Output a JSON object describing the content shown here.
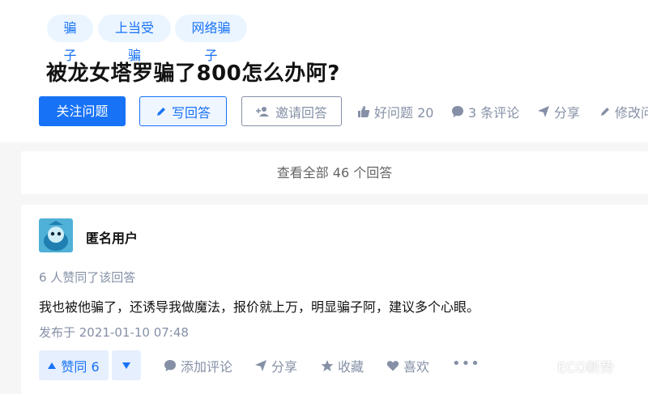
{
  "tags": [
    "骗子",
    "上当受骗",
    "网络骗子"
  ],
  "question": {
    "title": "被龙女塔罗骗了800怎么办阿?",
    "follow_label": "关注问题",
    "write_label": "写回答",
    "invite_label": "邀请回答",
    "good_question_label": "好问题 20",
    "comments_label": "3 条评论",
    "share_label": "分享",
    "edit_label": "修改问"
  },
  "view_all": "查看全部 46 个回答",
  "answer": {
    "author": "匿名用户",
    "likes_text": "6 人赞同了该回答",
    "content": "我也被他骗了，还诱导我做魔法，报价就上万，明显骗子阿，建议多个心眼。",
    "published": "发布于 2021-01-10 07:48",
    "vote_label": "赞同 6",
    "comment_label": "添加评论",
    "share_label": "分享",
    "collect_label": "收藏",
    "like_label": "喜欢",
    "more_label": "•••"
  },
  "watermark": "ECO新势",
  "colors": {
    "brand_blue": "#1772f6",
    "gray": "#8590a6",
    "tag_bg": "#ebf5ff"
  }
}
